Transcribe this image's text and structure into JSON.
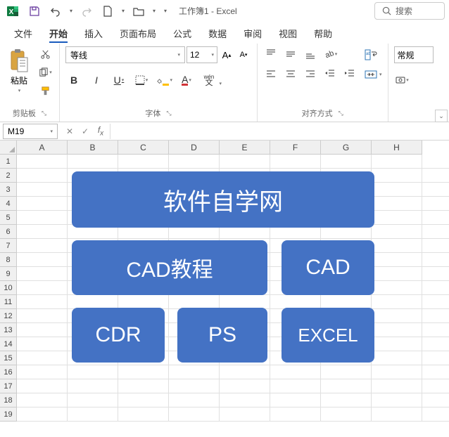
{
  "title": "工作簿1 - Excel",
  "search_placeholder": "搜索",
  "tabs": {
    "file": "文件",
    "home": "开始",
    "insert": "插入",
    "layout": "页面布局",
    "formulas": "公式",
    "data": "数据",
    "review": "审阅",
    "view": "视图",
    "help": "帮助"
  },
  "ribbon": {
    "paste": "粘贴",
    "clipboard_label": "剪贴板",
    "font_name": "等线",
    "font_size": "12",
    "bold": "B",
    "italic": "I",
    "underline": "U",
    "ruby": "wén",
    "ruby_sub": "文",
    "font_label": "字体",
    "align_label": "对齐方式",
    "number_format": "常规"
  },
  "namebox": "M19",
  "columns": [
    "A",
    "B",
    "C",
    "D",
    "E",
    "F",
    "G",
    "H"
  ],
  "rows": [
    "1",
    "2",
    "3",
    "4",
    "5",
    "6",
    "7",
    "8",
    "9",
    "10",
    "11",
    "12",
    "13",
    "14",
    "15",
    "16",
    "17",
    "18",
    "19"
  ],
  "shapes": {
    "title": "软件自学网",
    "cad_tutorial": "CAD教程",
    "cad": "CAD",
    "cdr": "CDR",
    "ps": "PS",
    "excel": "EXCEL"
  }
}
